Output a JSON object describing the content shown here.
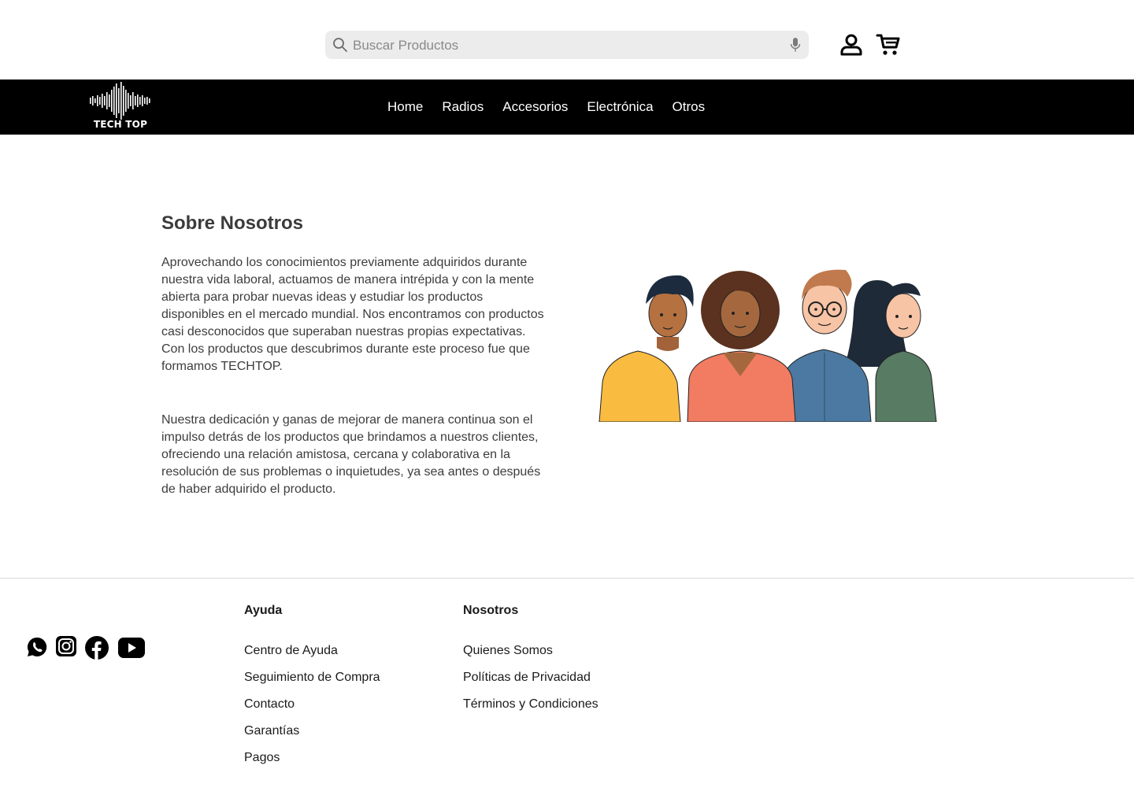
{
  "header": {
    "search_placeholder": "Buscar Productos"
  },
  "brand": {
    "logo_text": "TECH TOP"
  },
  "nav": {
    "items": [
      {
        "label": "Home"
      },
      {
        "label": "Radios"
      },
      {
        "label": "Accesorios"
      },
      {
        "label": "Electrónica"
      },
      {
        "label": "Otros"
      }
    ]
  },
  "about": {
    "title": "Sobre Nosotros",
    "paragraph1": "Aprovechando los conocimientos previamente adquiridos durante nuestra vida laboral, actuamos de manera intrépida y con la mente abierta para probar nuevas ideas y estudiar los productos disponibles en el mercado mundial. Nos encontramos con productos casi desconocidos que superaban nuestras propias expectativas. Con los productos que descubrimos durante este proceso fue que formamos TECHTOP.",
    "paragraph2": "Nuestra dedicación y ganas de mejorar de manera continua son el impulso detrás de los productos que brindamos a nuestros clientes, ofreciendo una relación amistosa, cercana y colaborativa en la resolución de sus problemas o inquietudes, ya sea antes o después de haber adquirido el producto."
  },
  "footer": {
    "social_icons": [
      "whatsapp-icon",
      "instagram-icon",
      "facebook-icon",
      "youtube-icon"
    ],
    "help": {
      "title": "Ayuda",
      "links": [
        "Centro de Ayuda",
        "Seguimiento de Compra",
        "Contacto",
        "Garantías",
        "Pagos"
      ]
    },
    "about": {
      "title": "Nosotros",
      "links": [
        "Quienes Somos",
        "Políticas de Privacidad",
        "Términos y Condiciones"
      ]
    }
  },
  "colors": {
    "nav_bg": "#000000",
    "search_bg": "#ececec",
    "text_dark": "#3b3b3b"
  }
}
